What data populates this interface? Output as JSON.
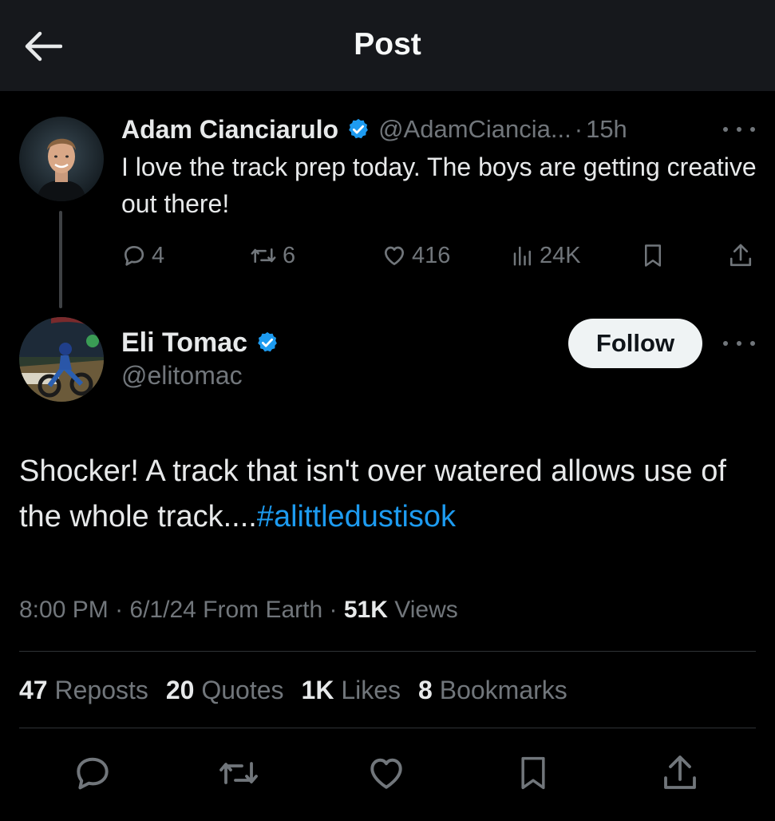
{
  "header": {
    "title": "Post"
  },
  "parent_post": {
    "author_name": "Adam Cianciarulo",
    "handle": "@AdamCiancia...",
    "separator": "·",
    "time": "15h",
    "text": "I love the track prep today. The boys are getting creative out there!",
    "replies": "4",
    "reposts": "6",
    "likes": "416",
    "views": "24K"
  },
  "post": {
    "author_name": "Eli Tomac",
    "handle": "@elitomac",
    "follow_label": "Follow",
    "text": "Shocker! A track that isn't over watered allows use of the whole track....",
    "hashtag": "#alittledustisok",
    "time": "8:00 PM",
    "sep1": " · ",
    "date": "6/1/24",
    "source": " From Earth",
    "sep2": " · ",
    "views_count": "51K",
    "views_label": " Views",
    "stats": {
      "reposts_count": "47",
      "reposts_label": " Reposts",
      "quotes_count": "20",
      "quotes_label": " Quotes",
      "likes_count": "1K",
      "likes_label": " Likes",
      "bookmarks_count": "8",
      "bookmarks_label": " Bookmarks"
    }
  },
  "colors": {
    "background": "#000000",
    "header_bg": "#16181c",
    "text": "#e7e9ea",
    "secondary_text": "#71767b",
    "link": "#1d9bf0",
    "verified": "#1d9bf0",
    "follow_bg": "#eff3f4"
  },
  "icons": {
    "back": "arrow-left-icon",
    "verified": "verified-badge-icon",
    "more": "more-horizontal-icon",
    "reply": "reply-icon",
    "repost": "repost-icon",
    "like": "heart-icon",
    "views": "views-bar-icon",
    "bookmark": "bookmark-icon",
    "share": "share-icon"
  }
}
